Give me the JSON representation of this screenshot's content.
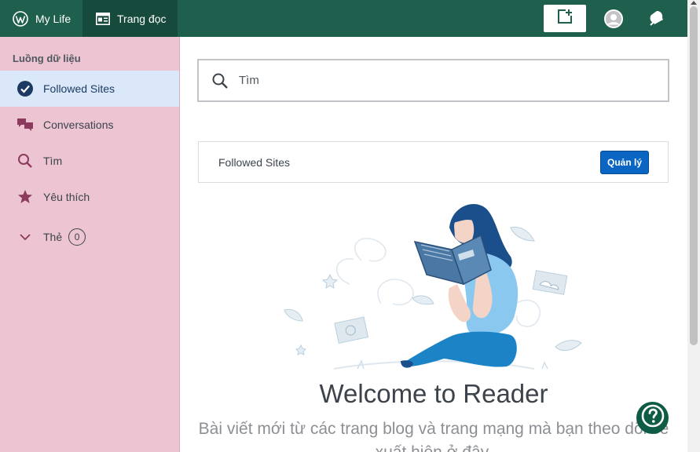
{
  "masterbar": {
    "my_site_label": "My Life",
    "reader_label": "Trang đọc"
  },
  "sidebar": {
    "heading": "Luồng dữ liệu",
    "items": [
      {
        "label": "Followed Sites",
        "icon": "checkmark-circle-icon",
        "active": true
      },
      {
        "label": "Conversations",
        "icon": "chat-bubbles-icon"
      },
      {
        "label": "Tìm",
        "icon": "search-icon"
      },
      {
        "label": "Yêu thích",
        "icon": "star-icon"
      }
    ],
    "tags": {
      "label": "Thẻ",
      "count": "0",
      "icon": "chevron-down-icon"
    }
  },
  "search": {
    "placeholder": "Tìm"
  },
  "followed": {
    "title": "Followed Sites",
    "manage_label": "Quản lý"
  },
  "welcome": {
    "title": "Welcome to Reader",
    "subtitle": "Bài viết mới từ các trang blog và trang mạng mà bạn theo dõi sẽ xuất hiện ở đây."
  },
  "colors": {
    "masterbar": "#1e5f4e",
    "sidebar": "#ecc4d2",
    "accent_button": "#0a66c2",
    "help_button": "#0f5c46"
  }
}
